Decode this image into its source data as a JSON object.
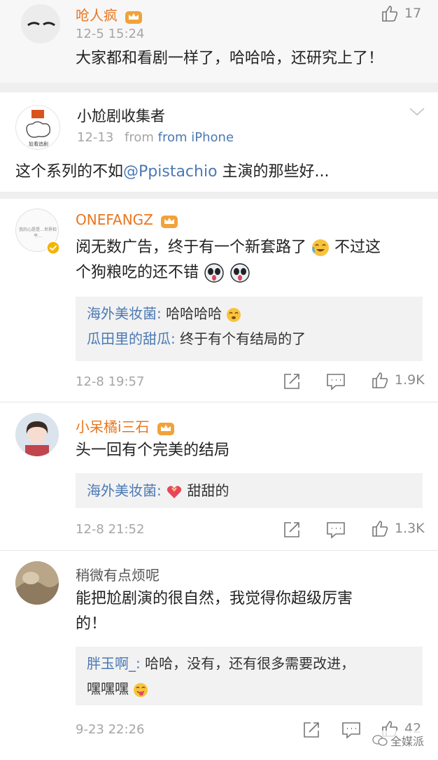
{
  "comments": [
    {
      "user": "呛人疯",
      "time": "12-5 15:24",
      "text": "大家都和看剧一样了，哈哈哈，还研究上了！",
      "likes": "17"
    },
    {
      "user": "小尬剧收集者",
      "time": "12-13",
      "source": "from iPhone",
      "text_before": "这个系列的不如",
      "mention": "@Ppistachio",
      "text_after": " 主演的那些好...",
      "avatar_caption": "尬看追剧"
    },
    {
      "user": "ONEFANGZ",
      "text_line1": "阅无数广告，终于有一个新套路了",
      "text_line1b": "不过这",
      "text_line2": "个狗粮吃的还不错",
      "replies": [
        {
          "name": "海外美妆菌:",
          "text": "哈哈哈哈"
        },
        {
          "name": "瓜田里的甜瓜:",
          "text": "终于有个有结局的了"
        }
      ],
      "time": "12-8 19:57",
      "likes": "1.9K",
      "avatar_caption": "我的心愿是...世界和平..."
    },
    {
      "user": "小呆橘i三石",
      "text": "头一回有个完美的结局",
      "replies": [
        {
          "name": "海外美妆菌:",
          "text": "甜甜的"
        }
      ],
      "time": "12-8 21:52",
      "likes": "1.3K"
    },
    {
      "user": "稍微有点烦呢",
      "text_line1": "能把尬剧演的很自然，我觉得你超级厉害",
      "text_line2": "的！",
      "replies": [
        {
          "name": "胖玉啊_:",
          "text_line1": "哈哈，没有，还有很多需要改进，",
          "text_line2": "嘿嘿嘿"
        }
      ],
      "time": "9-23 22:26",
      "likes": "42"
    }
  ],
  "watermark": "全媒派",
  "colors": {
    "orange_name": "#e8761f",
    "link_blue": "#4b79b4",
    "meta_gray": "#a6a6a6"
  }
}
